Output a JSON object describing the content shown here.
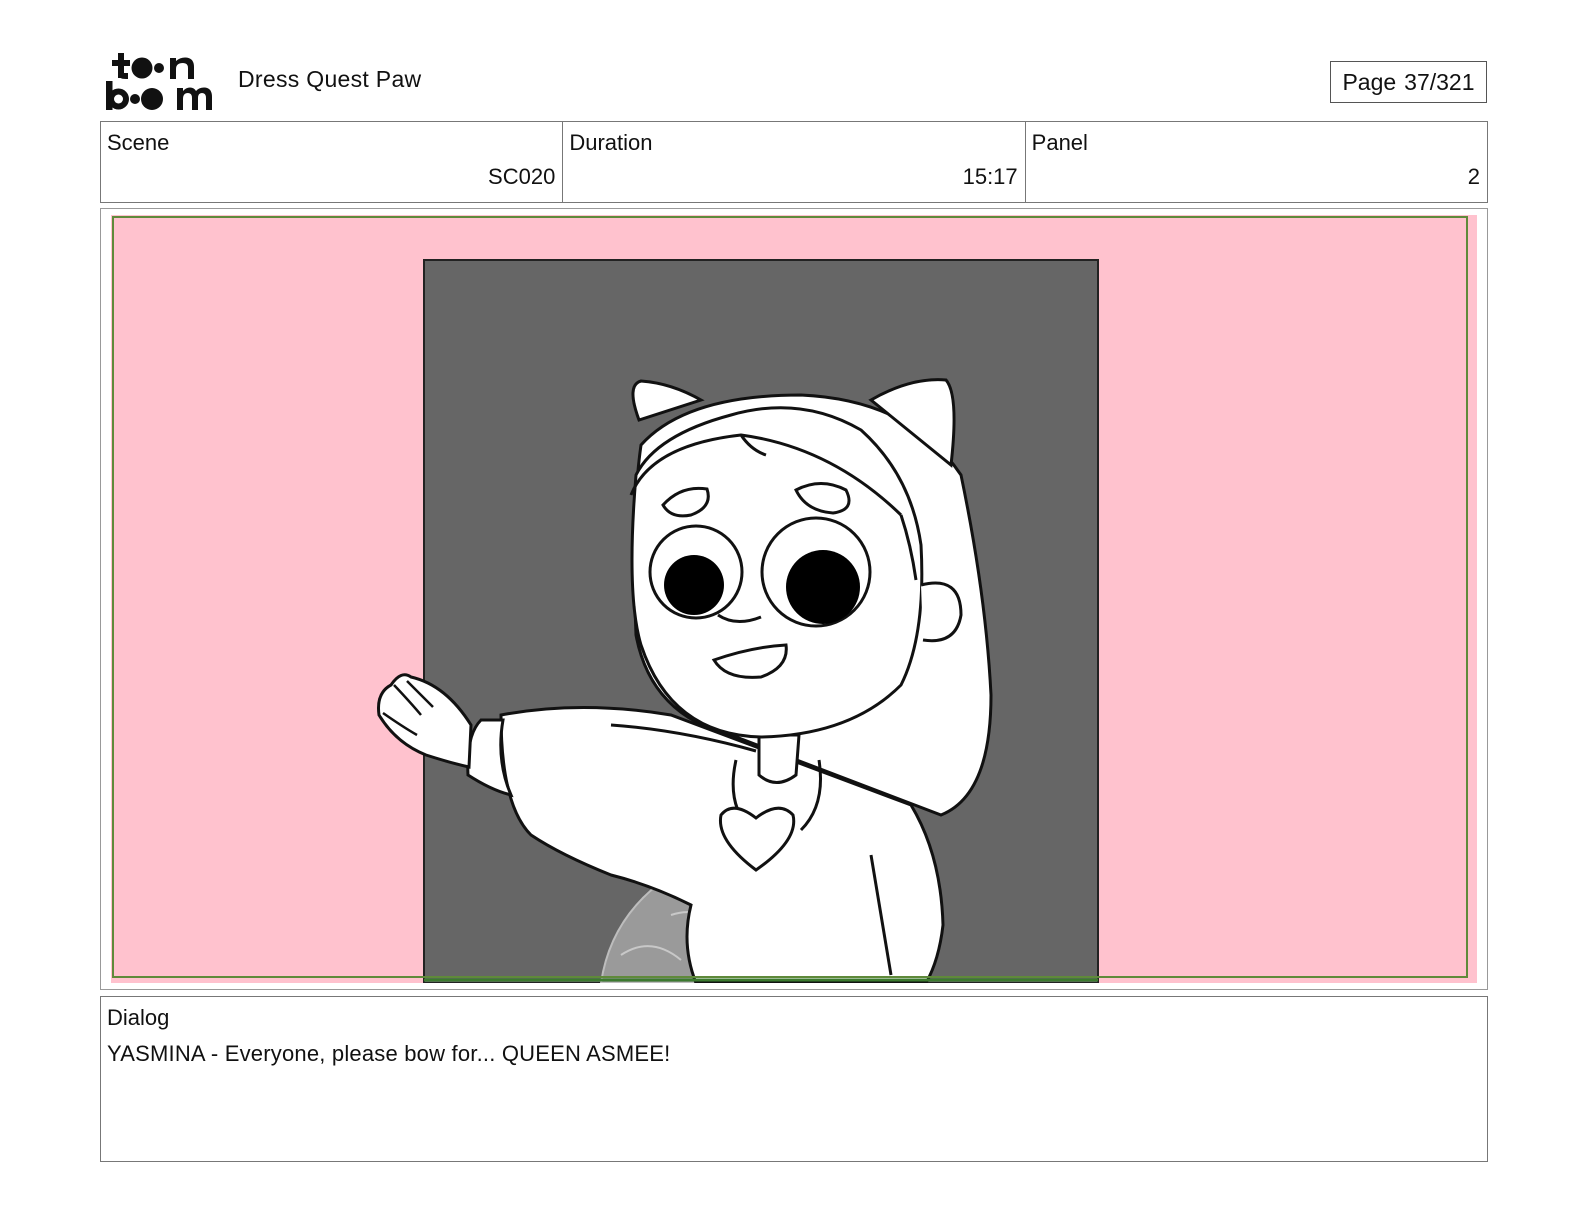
{
  "header": {
    "logo_text": "toon boom",
    "project_title": "Dress Quest Paw",
    "page_label": "Page",
    "page_number": "37/321"
  },
  "info": {
    "scene_label": "Scene",
    "scene_value": "SC020",
    "duration_label": "Duration",
    "duration_value": "15:17",
    "panel_label": "Panel",
    "panel_value": "2"
  },
  "panel": {
    "background_color": "#ffc2ce",
    "doorway_color": "#666666",
    "safe_frame_color": "#5f8a3a"
  },
  "dialog": {
    "label": "Dialog",
    "text": "YASMINA - Everyone, please bow for... QUEEN ASMEE!"
  }
}
